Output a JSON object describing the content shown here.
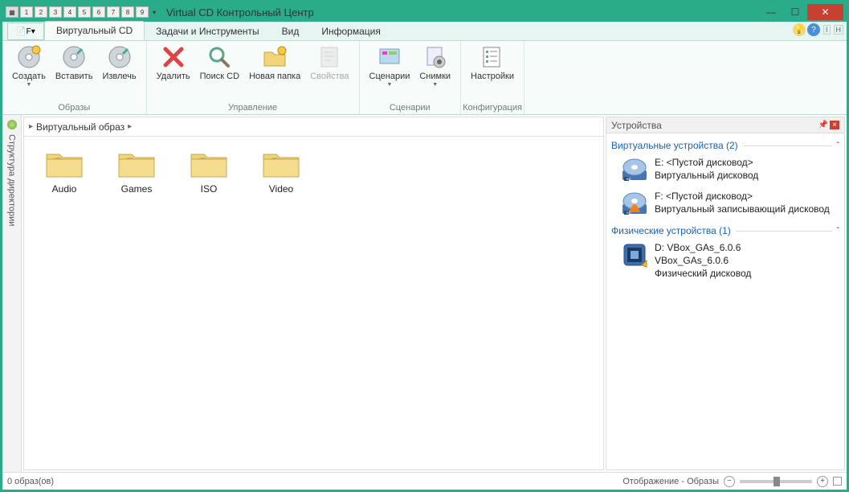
{
  "title": "Virtual CD Контрольный Центр",
  "qat": [
    "1",
    "2",
    "3",
    "4",
    "5",
    "6",
    "7",
    "8",
    "9"
  ],
  "tabs": {
    "file": "F",
    "items": [
      "Виртуальный CD",
      "Задачи и Инструменты",
      "Вид",
      "Информация"
    ],
    "active": 0,
    "help_hint": [
      "I",
      "H"
    ]
  },
  "ribbon": {
    "groups": [
      {
        "label": "Образы",
        "buttons": [
          {
            "label": "Создать",
            "drop": true
          },
          {
            "label": "Вставить"
          },
          {
            "label": "Извлечь"
          }
        ]
      },
      {
        "label": "Управление",
        "buttons": [
          {
            "label": "Удалить"
          },
          {
            "label": "Поиск CD"
          },
          {
            "label": "Новая папка"
          },
          {
            "label": "Свойства",
            "disabled": true
          }
        ]
      },
      {
        "label": "Сценарии",
        "buttons": [
          {
            "label": "Сценарии",
            "drop": true
          },
          {
            "label": "Снимки",
            "drop": true
          }
        ]
      },
      {
        "label": "Конфигурация",
        "buttons": [
          {
            "label": "Настройки"
          }
        ]
      }
    ]
  },
  "sidebar": {
    "label": "Структура директории"
  },
  "breadcrumb": {
    "root": "Виртуальный образ"
  },
  "folders": [
    "Audio",
    "Games",
    "ISO",
    "Video"
  ],
  "devices": {
    "title": "Устройства",
    "groups": [
      {
        "title": "Виртуальные устройства (2)",
        "items": [
          {
            "line1": "E: <Пустой дисковод>",
            "line2": "Виртуальный дисковод"
          },
          {
            "line1": "F: <Пустой дисковод>",
            "line2": "Виртуальный записывающий дисковод"
          }
        ]
      },
      {
        "title": "Физические устройства (1)",
        "items": [
          {
            "line1": "D: VBox_GAs_6.0.6",
            "line2": "VBox_GAs_6.0.6",
            "line3": "Физический дисковод"
          }
        ]
      }
    ]
  },
  "status": {
    "left": "0 образ(ов)",
    "right": "Отображение - Образы"
  }
}
